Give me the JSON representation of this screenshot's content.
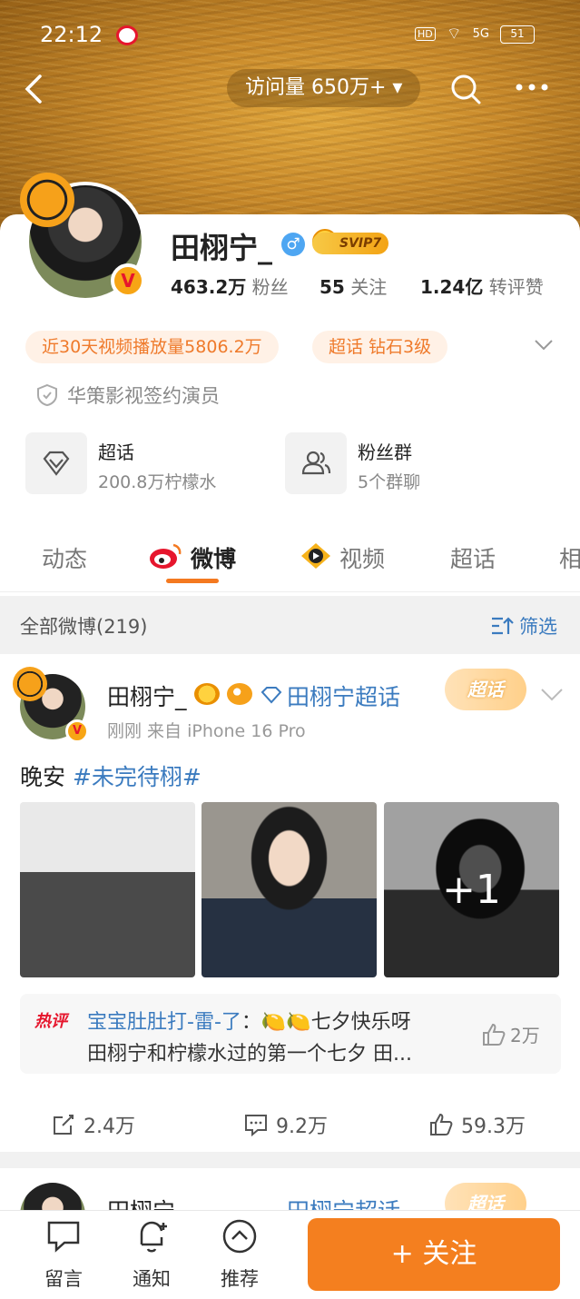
{
  "status_bar": {
    "time": "22:12",
    "network": "5G",
    "battery": "51"
  },
  "header": {
    "visit_count": "访问量 650万+ ▾"
  },
  "profile": {
    "name": "田栩宁_",
    "vip_badge": "SVIP7",
    "verified_badge": "V",
    "stats": [
      {
        "value": "463.2万",
        "label": "粉丝"
      },
      {
        "value": "55",
        "label": "关注"
      },
      {
        "value": "1.24亿",
        "label": "转评赞"
      }
    ],
    "tags": [
      "近30天视频播放量5806.2万",
      "超话 钻石3级"
    ],
    "verification": "华策影视签约演员",
    "features": [
      {
        "title": "超话",
        "subtitle": "200.8万柠檬水"
      },
      {
        "title": "粉丝群",
        "subtitle": "5个群聊"
      }
    ]
  },
  "tabs": [
    "动态",
    "微博",
    "视频",
    "超话",
    "相"
  ],
  "filter_bar": {
    "count_label": "全部微博(219)",
    "filter_label": "筛选"
  },
  "post": {
    "author": "田栩宁_",
    "supertopic": "田栩宁超话",
    "stamp": "超话",
    "meta": "刚刚  来自 iPhone 16 Pro",
    "text_plain": "晚安 ",
    "text_hashtag": "#未完待栩#",
    "more_photos": "+1",
    "hot_comment": {
      "label": "热评",
      "user": "宝宝肚肚打-雷-了",
      "line1": "：🍋🍋七夕快乐呀",
      "line2": "田栩宁和柠檬水过的第一个七夕 田...",
      "likes": "2万"
    },
    "actions": {
      "reposts": "2.4万",
      "comments": "9.2万",
      "likes": "59.3万"
    }
  },
  "post2": {
    "author": "田栩宁_",
    "supertopic": "田栩宁超话",
    "stamp": "超话"
  },
  "bottom_bar": {
    "items": [
      "留言",
      "通知",
      "推荐"
    ],
    "follow": "+ 关注"
  },
  "colors": {
    "accent": "#f47920",
    "link": "#3b7bbf",
    "weibo_red": "#e6162d"
  }
}
